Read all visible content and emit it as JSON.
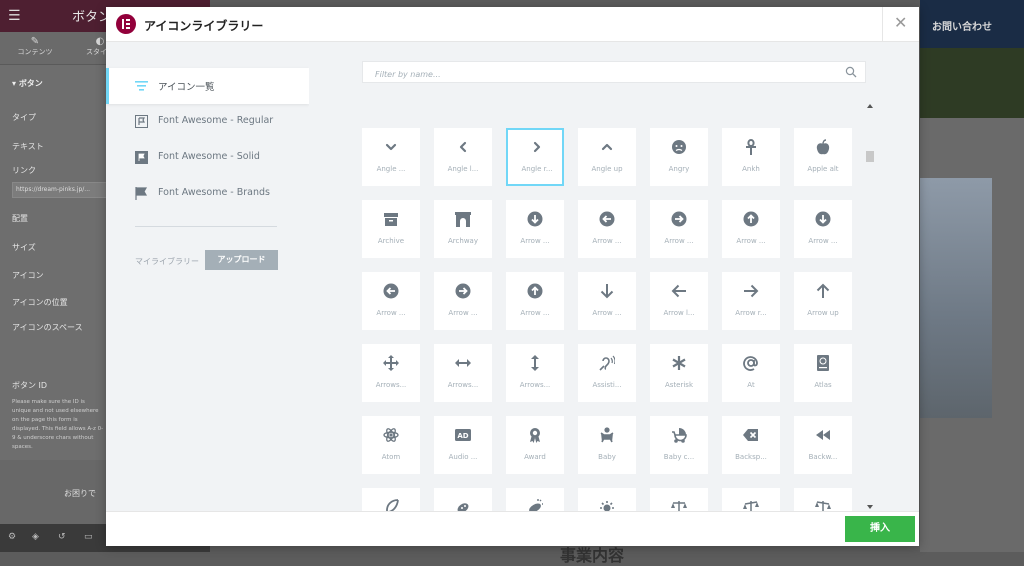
{
  "background": {
    "topbar_title": "ボタン",
    "tabs": [
      "コンテンツ",
      "スタイル"
    ],
    "section": "ボタン",
    "rows": [
      "タイプ",
      "テキスト",
      "リンク",
      "配置",
      "サイズ",
      "アイコン",
      "アイコンの位置",
      "アイコンのスペース",
      "ボタン ID"
    ],
    "link_value": "https://dream-pinks.jp/...",
    "help_text": "Please make sure the ID is unique and not used elsewhere on the page this form is displayed. This field allows A-z 0-9 & underscore chars without spaces.",
    "bottom_text": "お困りで",
    "right_header": "お問い合わせ",
    "bottom_headline": "事業内容"
  },
  "modal": {
    "title": "アイコンライブラリー",
    "sidebar": {
      "items": [
        {
          "label": "アイコン一覧",
          "icon": "list-icon"
        },
        {
          "label": "Font Awesome - Regular",
          "icon": "flag-regular-icon"
        },
        {
          "label": "Font Awesome - Solid",
          "icon": "flag-solid-icon"
        },
        {
          "label": "Font Awesome - Brands",
          "icon": "flag-brands-icon"
        }
      ],
      "my_library_label": "マイライブラリー",
      "upload_label": "アップロード"
    },
    "search": {
      "placeholder": "Filter by name..."
    },
    "icons": [
      {
        "name": "Angle ...",
        "icon": "angle-down-icon"
      },
      {
        "name": "Angle l...",
        "icon": "angle-left-icon"
      },
      {
        "name": "Angle r...",
        "icon": "angle-right-icon",
        "selected": true
      },
      {
        "name": "Angle up",
        "icon": "angle-up-icon"
      },
      {
        "name": "Angry",
        "icon": "angry-icon"
      },
      {
        "name": "Ankh",
        "icon": "ankh-icon"
      },
      {
        "name": "Apple alt",
        "icon": "apple-alt-icon"
      },
      {
        "name": "Archive",
        "icon": "archive-icon"
      },
      {
        "name": "Archway",
        "icon": "archway-icon"
      },
      {
        "name": "Arrow ...",
        "icon": "arrow-circle-down-icon"
      },
      {
        "name": "Arrow ...",
        "icon": "arrow-circle-left-icon"
      },
      {
        "name": "Arrow ...",
        "icon": "arrow-circle-right-icon"
      },
      {
        "name": "Arrow ...",
        "icon": "arrow-circle-up-icon"
      },
      {
        "name": "Arrow ...",
        "icon": "arrow-circle-down-icon"
      },
      {
        "name": "Arrow ...",
        "icon": "arrow-circle-left-icon"
      },
      {
        "name": "Arrow ...",
        "icon": "arrow-circle-right-icon"
      },
      {
        "name": "Arrow ...",
        "icon": "arrow-circle-up-icon"
      },
      {
        "name": "Arrow ...",
        "icon": "arrow-down-icon"
      },
      {
        "name": "Arrow l...",
        "icon": "arrow-left-icon"
      },
      {
        "name": "Arrow r...",
        "icon": "arrow-right-icon"
      },
      {
        "name": "Arrow up",
        "icon": "arrow-up-icon"
      },
      {
        "name": "Arrows...",
        "icon": "arrows-icon"
      },
      {
        "name": "Arrows...",
        "icon": "arrows-h-icon"
      },
      {
        "name": "Arrows...",
        "icon": "arrows-v-icon"
      },
      {
        "name": "Assisti...",
        "icon": "assistive-listening-icon"
      },
      {
        "name": "Asterisk",
        "icon": "asterisk-icon"
      },
      {
        "name": "At",
        "icon": "at-icon"
      },
      {
        "name": "Atlas",
        "icon": "atlas-icon"
      },
      {
        "name": "Atom",
        "icon": "atom-icon"
      },
      {
        "name": "Audio ...",
        "icon": "audio-description-icon"
      },
      {
        "name": "Award",
        "icon": "award-icon"
      },
      {
        "name": "Baby",
        "icon": "baby-icon"
      },
      {
        "name": "Baby c...",
        "icon": "baby-carriage-icon"
      },
      {
        "name": "Backsp...",
        "icon": "backspace-icon"
      },
      {
        "name": "Backw...",
        "icon": "backward-icon"
      },
      {
        "name": "",
        "icon": "feather-icon"
      },
      {
        "name": "",
        "icon": "bacteria-icon"
      },
      {
        "name": "",
        "icon": "bacterium-icon"
      },
      {
        "name": "",
        "icon": "sun-icon"
      },
      {
        "name": "",
        "icon": "balance-scale-icon"
      },
      {
        "name": "",
        "icon": "balance-scale-left-icon"
      },
      {
        "name": "",
        "icon": "balance-scale-right-icon"
      }
    ],
    "insert_label": "挿入"
  },
  "colors": {
    "accent_blue": "#71d7f7",
    "insert_green": "#39b54a",
    "brand": "#92003b",
    "icon_gray": "#6d7882"
  }
}
